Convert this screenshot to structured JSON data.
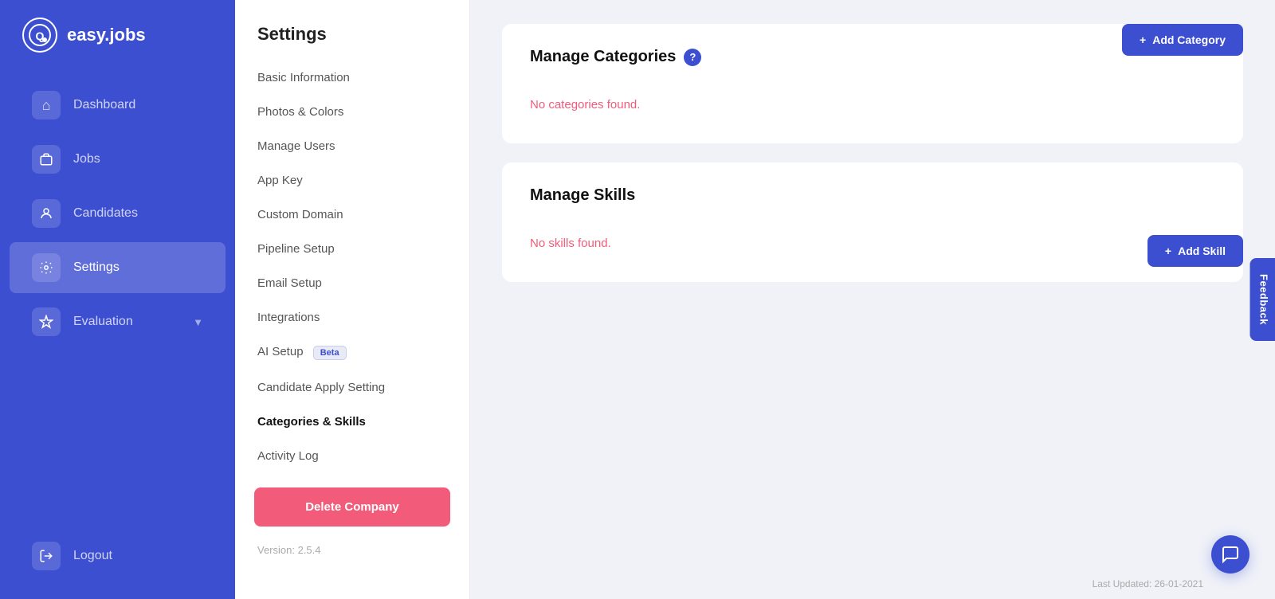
{
  "app": {
    "logo_text": "easy.jobs",
    "logo_icon": "Q"
  },
  "sidebar": {
    "items": [
      {
        "id": "dashboard",
        "label": "Dashboard",
        "icon": "⌂",
        "active": false
      },
      {
        "id": "jobs",
        "label": "Jobs",
        "icon": "💼",
        "active": false
      },
      {
        "id": "candidates",
        "label": "Candidates",
        "icon": "👤",
        "active": false
      },
      {
        "id": "settings",
        "label": "Settings",
        "icon": "⚙",
        "active": true
      },
      {
        "id": "evaluation",
        "label": "Evaluation",
        "icon": "🎓",
        "active": false,
        "has_chevron": true
      }
    ],
    "logout_label": "Logout"
  },
  "settings": {
    "page_title": "Settings",
    "menu_items": [
      {
        "id": "basic-info",
        "label": "Basic Information",
        "type": "link"
      },
      {
        "id": "photos-colors",
        "label": "Photos & Colors",
        "type": "link"
      },
      {
        "id": "manage-users",
        "label": "Manage Users",
        "type": "link"
      },
      {
        "id": "app-key",
        "label": "App Key",
        "type": "link"
      },
      {
        "id": "custom-domain",
        "label": "Custom Domain",
        "type": "link"
      },
      {
        "id": "pipeline-setup",
        "label": "Pipeline Setup",
        "type": "link"
      },
      {
        "id": "email-setup",
        "label": "Email Setup",
        "type": "link"
      },
      {
        "id": "integrations",
        "label": "Integrations",
        "type": "link"
      },
      {
        "id": "ai-setup",
        "label": "AI Setup",
        "type": "link",
        "badge": "Beta"
      },
      {
        "id": "candidate-apply",
        "label": "Candidate Apply Setting",
        "type": "link"
      },
      {
        "id": "categories-skills",
        "label": "Categories & Skills",
        "type": "heading"
      },
      {
        "id": "activity-log",
        "label": "Activity Log",
        "type": "link"
      }
    ],
    "delete_company_label": "Delete Company",
    "version_label": "Version: 2.5.4"
  },
  "manage_categories": {
    "title": "Manage Categories",
    "empty_message": "No categories found.",
    "add_button": "+ Add Category"
  },
  "manage_skills": {
    "title": "Manage Skills",
    "empty_message": "No skills found.",
    "add_button": "+ Add Skill"
  },
  "footer": {
    "last_updated": "Last Updated: 26-01-2021"
  },
  "feedback_label": "Feedback"
}
